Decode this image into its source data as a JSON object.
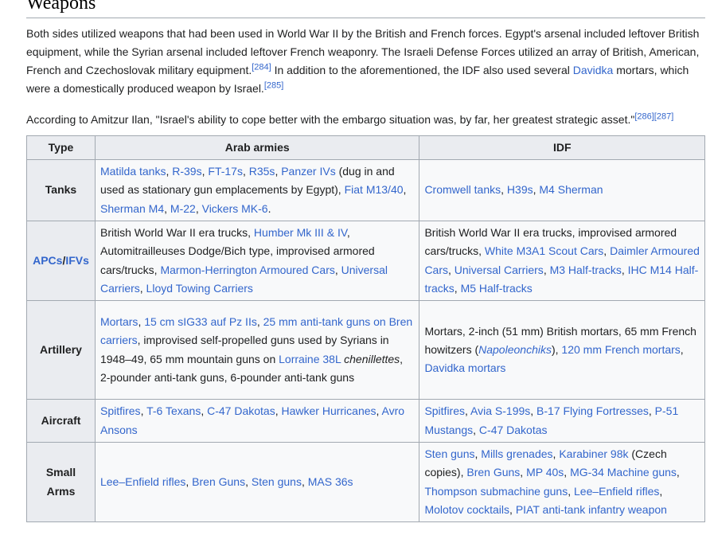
{
  "heading": "Weapons",
  "para1": {
    "t1": "Both sides utilized weapons that had been used in World War II by the British and French forces. Egypt's arsenal included leftover British equipment, while the Syrian arsenal included leftover French weaponry. The Israeli Defense Forces utilized an array of British, American, French and Czechoslovak military equipment.",
    "ref1": "[284]",
    "t2": " In addition to the aforementioned, the IDF also used several ",
    "link1": "Davidka",
    "t3": " mortars, which were a domestically produced weapon by Israel.",
    "ref2": "[285]"
  },
  "para2": {
    "t1": "According to Amitzur Ilan, \"Israel's ability to cope better with the embargo situation was, by far, her greatest strategic asset.\"",
    "ref1": "[286]",
    "ref2": "[287]"
  },
  "table": {
    "headers": [
      "Type",
      "Arab armies",
      "IDF"
    ],
    "rows": [
      {
        "type": "Tanks",
        "arab": [
          {
            "text": "Matilda tanks",
            "link": true
          },
          {
            "text": ", ",
            "link": false
          },
          {
            "text": "R-39s",
            "link": true
          },
          {
            "text": ", ",
            "link": false
          },
          {
            "text": "FT-17s",
            "link": true
          },
          {
            "text": ", ",
            "link": false
          },
          {
            "text": "R35s",
            "link": true
          },
          {
            "text": ", ",
            "link": false
          },
          {
            "text": "Panzer IVs",
            "link": true
          },
          {
            "text": " (dug in and used as stationary gun emplacements by Egypt), ",
            "link": false
          },
          {
            "text": "Fiat M13/40",
            "link": true
          },
          {
            "text": ", ",
            "link": false
          },
          {
            "text": "Sherman M4",
            "link": true
          },
          {
            "text": ", ",
            "link": false
          },
          {
            "text": "M-22",
            "link": true
          },
          {
            "text": ", ",
            "link": false
          },
          {
            "text": "Vickers MK-6",
            "link": true
          },
          {
            "text": ".",
            "link": false
          }
        ],
        "idf": [
          {
            "text": "Cromwell tanks",
            "link": true
          },
          {
            "text": ", ",
            "link": false
          },
          {
            "text": "H39s",
            "link": true
          },
          {
            "text": ", ",
            "link": false
          },
          {
            "text": "M4 Sherman",
            "link": true
          }
        ]
      },
      {
        "type": "",
        "type_parts": [
          "APCs",
          "/",
          "IFVs"
        ],
        "arab": [
          {
            "text": "British World War II era trucks, ",
            "link": false
          },
          {
            "text": "Humber Mk III & IV",
            "link": true
          },
          {
            "text": ", Automitrailleuses Dodge/Bich type, improvised armored cars/trucks, ",
            "link": false
          },
          {
            "text": "Marmon-Herrington Armoured Cars",
            "link": true
          },
          {
            "text": ", ",
            "link": false
          },
          {
            "text": "Universal Carriers",
            "link": true
          },
          {
            "text": ", ",
            "link": false
          },
          {
            "text": "Lloyd Towing Carriers",
            "link": true
          }
        ],
        "idf": [
          {
            "text": "British World War II era trucks, improvised armored cars/trucks, ",
            "link": false
          },
          {
            "text": "White M3A1 Scout Cars",
            "link": true
          },
          {
            "text": ", ",
            "link": false
          },
          {
            "text": "Daimler Armoured Cars",
            "link": true
          },
          {
            "text": ", ",
            "link": false
          },
          {
            "text": "Universal Carriers",
            "link": true
          },
          {
            "text": ", ",
            "link": false
          },
          {
            "text": "M3 Half-tracks",
            "link": true
          },
          {
            "text": ", ",
            "link": false
          },
          {
            "text": "IHC M14 Half-tracks",
            "link": true
          },
          {
            "text": ", ",
            "link": false
          },
          {
            "text": "M5 Half-tracks",
            "link": true
          }
        ]
      },
      {
        "type": "Artillery",
        "arab": [
          {
            "text": "Mortars",
            "link": true
          },
          {
            "text": ", ",
            "link": false
          },
          {
            "text": "15 cm sIG33 auf Pz IIs",
            "link": true
          },
          {
            "text": ", ",
            "link": false
          },
          {
            "text": "25 mm anti-tank guns on Bren carriers",
            "link": true
          },
          {
            "text": ", improvised self-propelled guns used by Syrians in 1948–49, 65 mm mountain guns on ",
            "link": false
          },
          {
            "text": "Lorraine 38L",
            "link": true
          },
          {
            "text": " ",
            "link": false
          },
          {
            "text": "chenillettes",
            "link": false,
            "italic": true
          },
          {
            "text": ", 2-pounder anti-tank guns, 6-pounder anti-tank guns",
            "link": false
          }
        ],
        "idf": [
          {
            "text": "Mortars, 2-inch (51 mm) British mortars, 65 mm French howitzers (",
            "link": false
          },
          {
            "text": "Napoleonchiks",
            "link": true,
            "italic": true
          },
          {
            "text": "), ",
            "link": false
          },
          {
            "text": "120 mm French mortars",
            "link": true
          },
          {
            "text": ", ",
            "link": false
          },
          {
            "text": "Davidka mortars",
            "link": true
          }
        ]
      },
      {
        "type": "Aircraft",
        "arab": [
          {
            "text": "Spitfires",
            "link": true
          },
          {
            "text": ", ",
            "link": false
          },
          {
            "text": "T-6 Texans",
            "link": true
          },
          {
            "text": ", ",
            "link": false
          },
          {
            "text": "C-47 Dakotas",
            "link": true
          },
          {
            "text": ", ",
            "link": false
          },
          {
            "text": "Hawker Hurricanes",
            "link": true
          },
          {
            "text": ", ",
            "link": false
          },
          {
            "text": "Avro Ansons",
            "link": true
          }
        ],
        "idf": [
          {
            "text": "Spitfires",
            "link": true
          },
          {
            "text": ", ",
            "link": false
          },
          {
            "text": "Avia S-199s",
            "link": true
          },
          {
            "text": ", ",
            "link": false
          },
          {
            "text": "B-17 Flying Fortresses",
            "link": true
          },
          {
            "text": ", ",
            "link": false
          },
          {
            "text": "P-51 Mustangs",
            "link": true
          },
          {
            "text": ", ",
            "link": false
          },
          {
            "text": "C-47 Dakotas",
            "link": true
          }
        ]
      },
      {
        "type": "Small Arms",
        "arab": [
          {
            "text": "Lee–Enfield rifles",
            "link": true
          },
          {
            "text": ", ",
            "link": false
          },
          {
            "text": "Bren Guns",
            "link": true
          },
          {
            "text": ", ",
            "link": false
          },
          {
            "text": "Sten guns",
            "link": true
          },
          {
            "text": ", ",
            "link": false
          },
          {
            "text": "MAS 36s",
            "link": true
          }
        ],
        "idf": [
          {
            "text": "Sten guns",
            "link": true
          },
          {
            "text": ", ",
            "link": false
          },
          {
            "text": "Mills grenades",
            "link": true
          },
          {
            "text": ", ",
            "link": false
          },
          {
            "text": "Karabiner 98k",
            "link": true
          },
          {
            "text": " (Czech copies), ",
            "link": false
          },
          {
            "text": "Bren Guns",
            "link": true
          },
          {
            "text": ", ",
            "link": false
          },
          {
            "text": "MP 40s",
            "link": true
          },
          {
            "text": ", ",
            "link": false
          },
          {
            "text": "MG-34 Machine guns",
            "link": true
          },
          {
            "text": ", ",
            "link": false
          },
          {
            "text": "Thompson submachine guns",
            "link": true
          },
          {
            "text": ", ",
            "link": false
          },
          {
            "text": "Lee–Enfield rifles",
            "link": true
          },
          {
            "text": ", ",
            "link": false
          },
          {
            "text": "Molotov cocktails",
            "link": true
          },
          {
            "text": ", ",
            "link": false
          },
          {
            "text": "PIAT anti-tank infantry weapon",
            "link": true
          }
        ]
      }
    ]
  },
  "colors": {
    "link": "#3366cc",
    "text": "#202122",
    "header_bg": "#eaecf0",
    "cell_bg": "#f8f9fa",
    "border": "#a2a9b1"
  }
}
